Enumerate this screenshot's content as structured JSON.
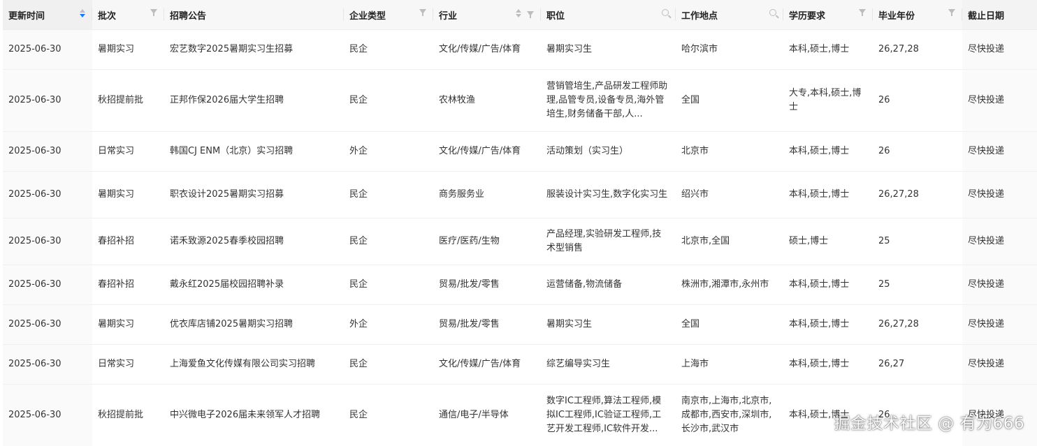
{
  "columns": [
    {
      "label": "更新时间",
      "control": "sort"
    },
    {
      "label": "批次",
      "control": "filter"
    },
    {
      "label": "招聘公告",
      "control": "none"
    },
    {
      "label": "企业类型",
      "control": "filter"
    },
    {
      "label": "行业",
      "control": "sort-filter"
    },
    {
      "label": "职位",
      "control": "search"
    },
    {
      "label": "工作地点",
      "control": "search"
    },
    {
      "label": "学历要求",
      "control": "filter"
    },
    {
      "label": "毕业年份",
      "control": "filter"
    },
    {
      "label": "截止日期",
      "control": "none"
    }
  ],
  "rows": [
    {
      "date": "2025-06-30",
      "batch": "暑期实习",
      "notice": "宏艺数字2025暑期实习生招募",
      "company_type": "民企",
      "industry": "文化/传媒/广告/体育",
      "position": "暑期实习生",
      "location": "哈尔滨市",
      "degree": "本科,硕士,博士",
      "grad_year": "26,27,28",
      "deadline": "尽快投递"
    },
    {
      "date": "2025-06-30",
      "batch": "秋招提前批",
      "notice": "正邦作保2026届大学生招聘",
      "company_type": "民企",
      "industry": "农林牧渔",
      "position": "营销管培生,产品研发工程师助理,品管专员,设备专员,海外管培生,财务储备干部,人...",
      "location": "全国",
      "degree": "大专,本科,硕士,博士",
      "grad_year": "26",
      "deadline": "尽快投递"
    },
    {
      "date": "2025-06-30",
      "batch": "日常实习",
      "notice": "韩国CJ ENM（北京）实习招聘",
      "company_type": "外企",
      "industry": "文化/传媒/广告/体育",
      "position": "活动策划（实习生）",
      "location": "北京市",
      "degree": "本科,硕士,博士",
      "grad_year": "26",
      "deadline": "尽快投递"
    },
    {
      "date": "2025-06-30",
      "batch": "暑期实习",
      "notice": "职衣设计2025暑期实习招募",
      "company_type": "民企",
      "industry": "商务服务业",
      "position": "服装设计实习生,数字化实习生",
      "location": "绍兴市",
      "degree": "本科,硕士,博士",
      "grad_year": "26,27,28",
      "deadline": "尽快投递"
    },
    {
      "date": "2025-06-30",
      "batch": "春招补招",
      "notice": "诺禾致源2025春季校园招聘",
      "company_type": "民企",
      "industry": "医疗/医药/生物",
      "position": "产品经理,实验研发工程师,技术型销售",
      "location": "北京市,全国",
      "degree": "硕士,博士",
      "grad_year": "25",
      "deadline": "尽快投递"
    },
    {
      "date": "2025-06-30",
      "batch": "春招补招",
      "notice": "戴永红2025届校园招聘补录",
      "company_type": "民企",
      "industry": "贸易/批发/零售",
      "position": "运营储备,物流储备",
      "location": "株洲市,湘潭市,永州市",
      "degree": "本科,硕士,博士",
      "grad_year": "25",
      "deadline": "尽快投递"
    },
    {
      "date": "2025-06-30",
      "batch": "暑期实习",
      "notice": "优衣库店铺2025暑期实习招聘",
      "company_type": "外企",
      "industry": "贸易/批发/零售",
      "position": "暑期实习生",
      "location": "全国",
      "degree": "本科,硕士,博士",
      "grad_year": "26,27,28",
      "deadline": "尽快投递"
    },
    {
      "date": "2025-06-30",
      "batch": "日常实习",
      "notice": "上海爱鱼文化传媒有限公司实习招聘",
      "company_type": "民企",
      "industry": "文化/传媒/广告/体育",
      "position": "综艺编导实习生",
      "location": "上海市",
      "degree": "本科,硕士,博士",
      "grad_year": "26,27",
      "deadline": "尽快投递"
    },
    {
      "date": "2025-06-30",
      "batch": "秋招提前批",
      "notice": "中兴微电子2026届未来领军人才招聘",
      "company_type": "民企",
      "industry": "通信/电子/半导体",
      "position": "数字IC工程师,算法工程师,模拟IC工程师,IC验证工程师,工艺开发工程师,IC软件开发...",
      "location": "南京市,上海市,北京市,成都市,西安市,深圳市,长沙市,武汉市",
      "degree": "本科,硕士,博士",
      "grad_year": "26",
      "deadline": "尽快投递"
    }
  ],
  "watermark": "掘金技术社区 @ 有为666"
}
